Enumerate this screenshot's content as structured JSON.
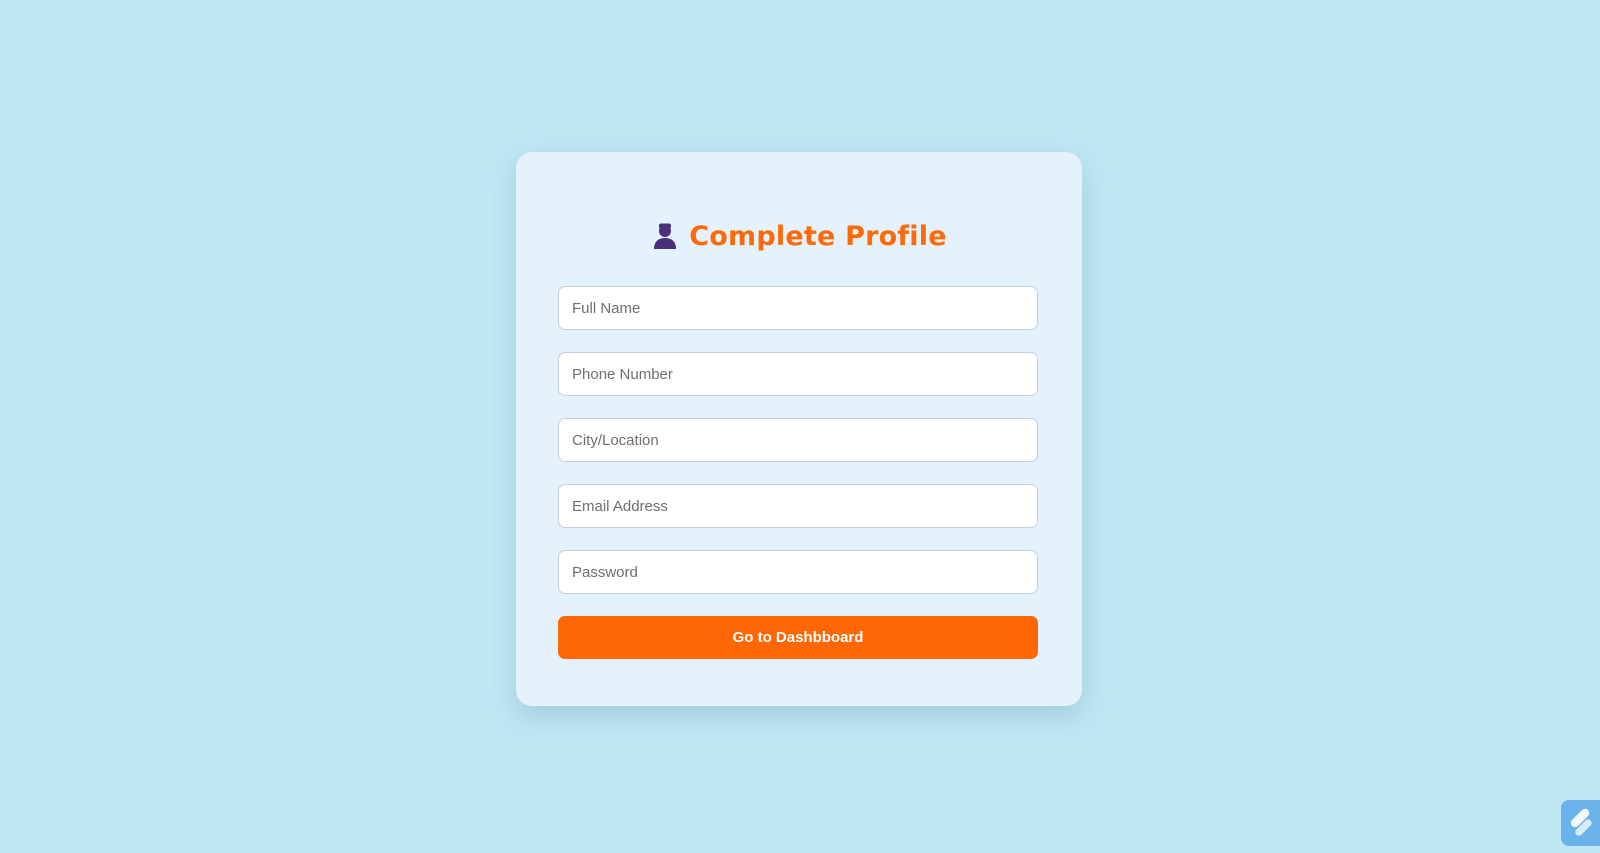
{
  "header": {
    "title": "Complete Profile",
    "icon": "user-icon"
  },
  "form": {
    "full_name": {
      "placeholder": "Full Name",
      "value": ""
    },
    "phone_number": {
      "placeholder": "Phone Number",
      "value": ""
    },
    "city_location": {
      "placeholder": "City/Location",
      "value": ""
    },
    "email_address": {
      "placeholder": "Email Address",
      "value": ""
    },
    "password": {
      "placeholder": "Password",
      "value": ""
    },
    "submit_label": "Go to Dashbboard"
  },
  "corner_widget": {
    "icon": "brand-logo-icon"
  },
  "colors": {
    "background": "#bfe7f4",
    "card": "#e3f2fc",
    "accent": "#ff6605",
    "title": "#ff6a08",
    "user_icon": "#4a2f7a",
    "corner_widget": "#6ab2ea"
  }
}
